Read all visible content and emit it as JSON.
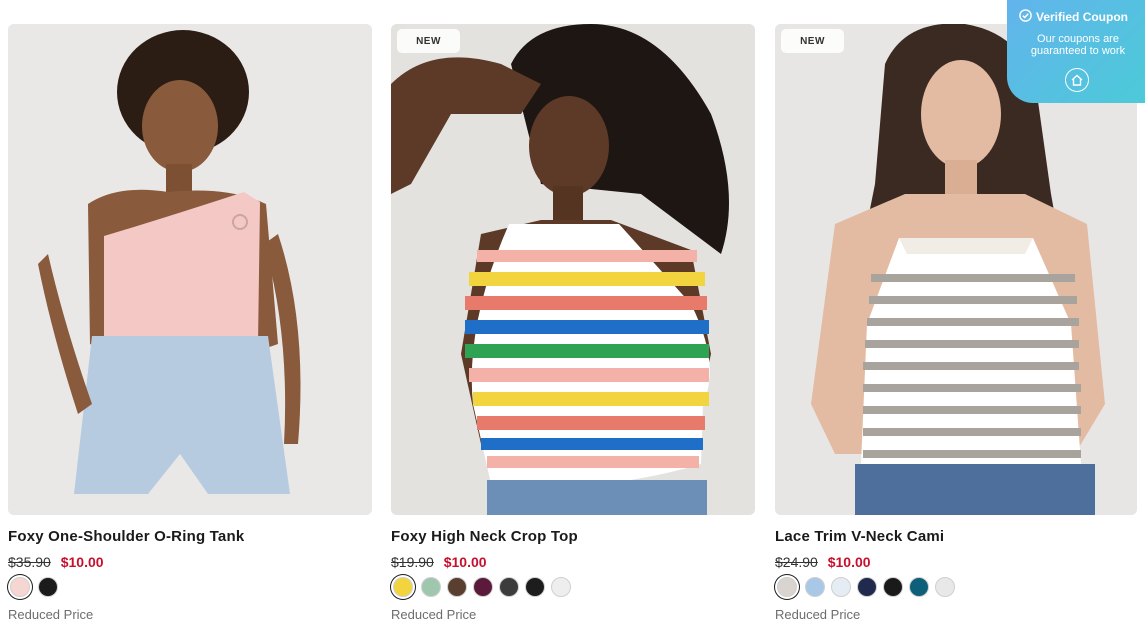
{
  "coupon": {
    "title": "Verified Coupon",
    "subtitle": "Our coupons are guaranteed to work",
    "icon": "check-circle-icon",
    "home_icon": "home-icon"
  },
  "products": [
    {
      "badge": "",
      "title": "Foxy One-Shoulder O-Ring Tank",
      "old_price": "$35.90",
      "new_price": "$10.00",
      "status": "Reduced Price",
      "swatches": [
        "#f6d6d0",
        "#1b1b1b"
      ],
      "selected_swatch": 0
    },
    {
      "badge": "NEW",
      "title": "Foxy High Neck Crop Top",
      "old_price": "$19.90",
      "new_price": "$10.00",
      "status": "Reduced Price",
      "swatches": [
        "#f2d43e",
        "#9fc7ae",
        "#5a3f30",
        "#5b1a3a",
        "#3c3c3c",
        "#1d1d1d",
        "#eeeeee"
      ],
      "selected_swatch": 0
    },
    {
      "badge": "NEW",
      "title": "Lace Trim V-Neck Cami",
      "old_price": "$24.90",
      "new_price": "$10.00",
      "status": "Reduced Price",
      "swatches": [
        "#d9d4cf",
        "#a9c8e8",
        "#e5ecf4",
        "#1f2a4d",
        "#1a1a1a",
        "#0d5f7a",
        "#e8e8e8"
      ],
      "selected_swatch": 0
    }
  ]
}
